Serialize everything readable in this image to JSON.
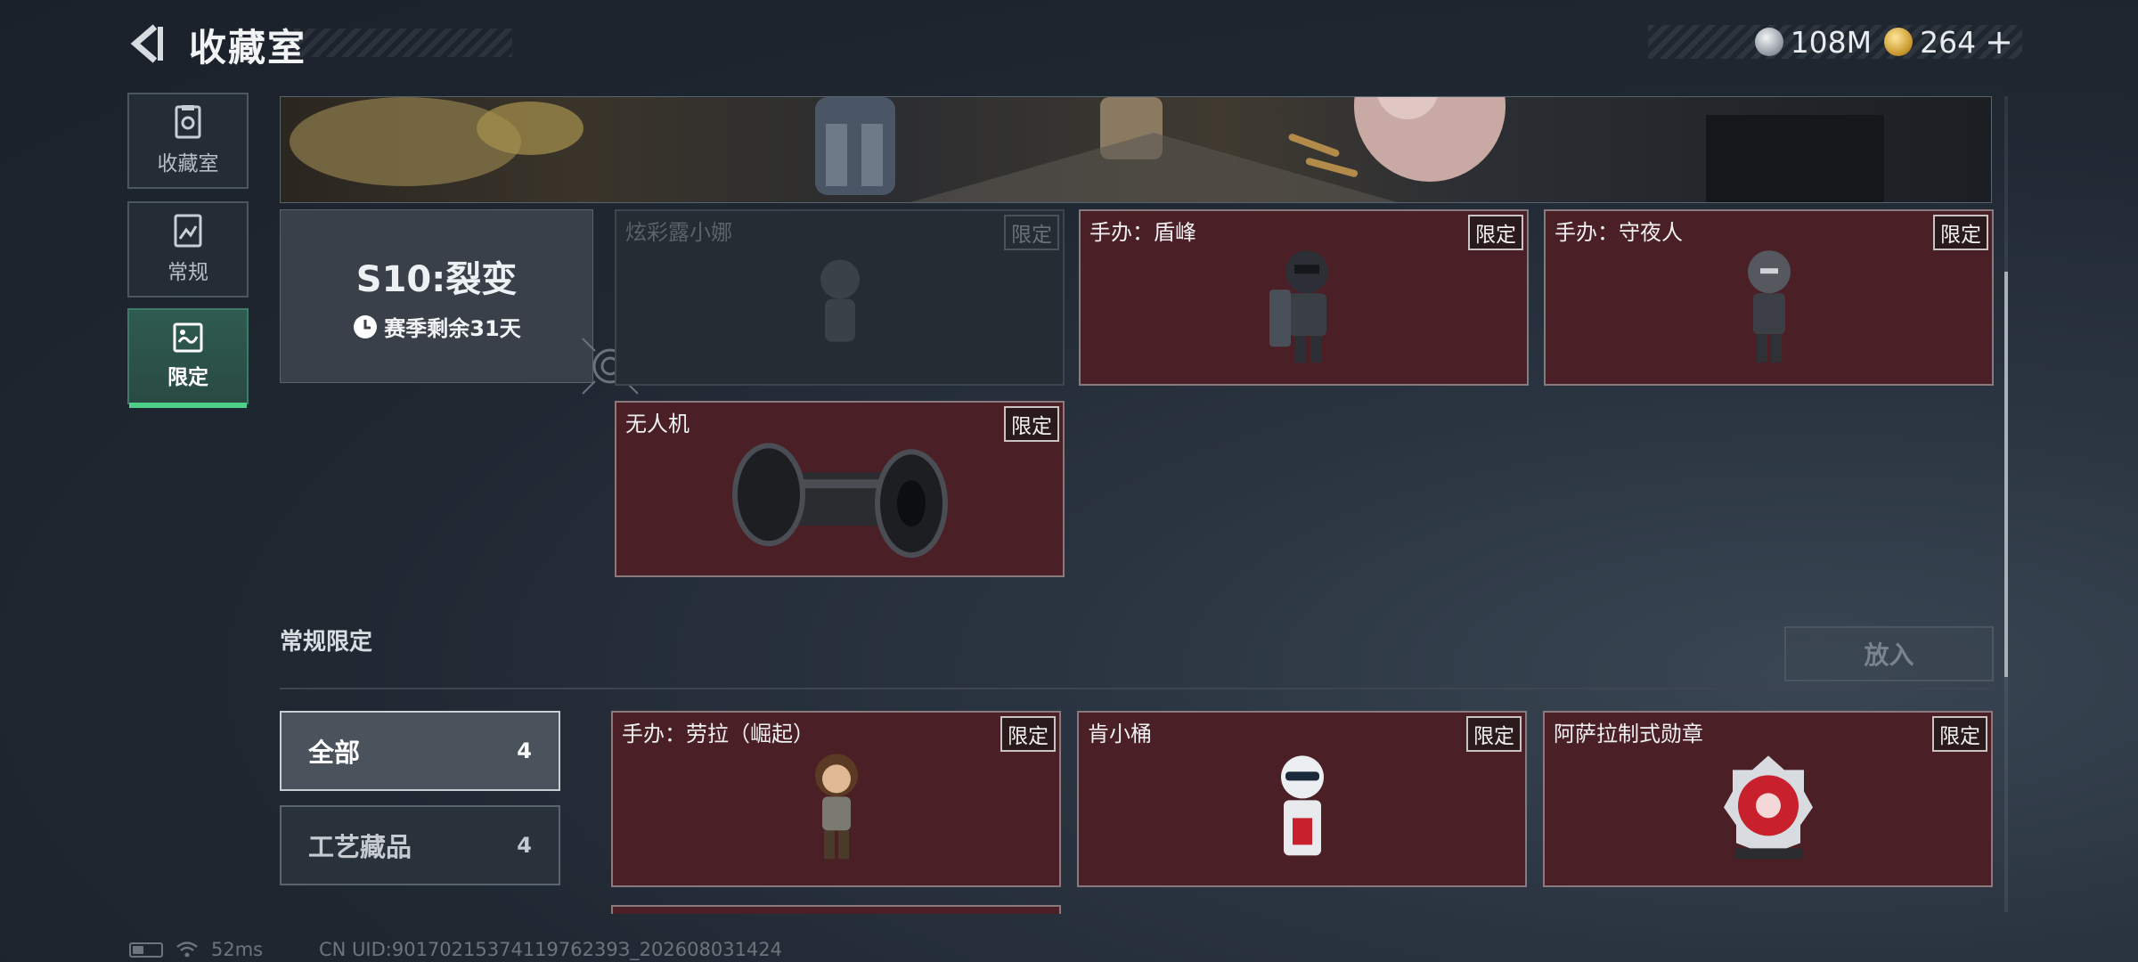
{
  "header": {
    "title": "收藏室",
    "currencies": [
      {
        "icon": "silver-coin-icon",
        "value": "108M"
      },
      {
        "icon": "gold-coin-icon",
        "value": "264"
      }
    ],
    "add_symbol": "+"
  },
  "sidebar": {
    "items": [
      {
        "label": "收藏室",
        "icon": "collection-room-icon"
      },
      {
        "label": "常规",
        "icon": "regular-icon"
      },
      {
        "label": "限定",
        "icon": "limited-icon",
        "active": true
      }
    ]
  },
  "season": {
    "title": "S10:裂变",
    "remaining": "赛季剩余31天"
  },
  "limited_items": [
    {
      "name": "炫彩露小娜",
      "badge": "限定",
      "disabled": true
    },
    {
      "name": "手办：盾峰",
      "badge": "限定"
    },
    {
      "name": "手办：守夜人",
      "badge": "限定"
    },
    {
      "name": "无人机",
      "badge": "限定"
    }
  ],
  "regular_section": {
    "title": "常规限定",
    "put_button": "放入",
    "filters": [
      {
        "label": "全部",
        "count": "4",
        "active": true
      },
      {
        "label": "工艺藏品",
        "count": "4"
      }
    ],
    "items": [
      {
        "name": "手办：劳拉（崛起）",
        "badge": "限定"
      },
      {
        "name": "肯小桶",
        "badge": "限定"
      },
      {
        "name": "阿萨拉制式勋章",
        "badge": "限定"
      }
    ]
  },
  "footer": {
    "ping": "52ms",
    "uid": "CN UID:9017021537411976239З_202608031424"
  },
  "colors": {
    "accent_green": "#4fd08a",
    "card_red": "#4a1f25",
    "background": "#1f2731"
  }
}
